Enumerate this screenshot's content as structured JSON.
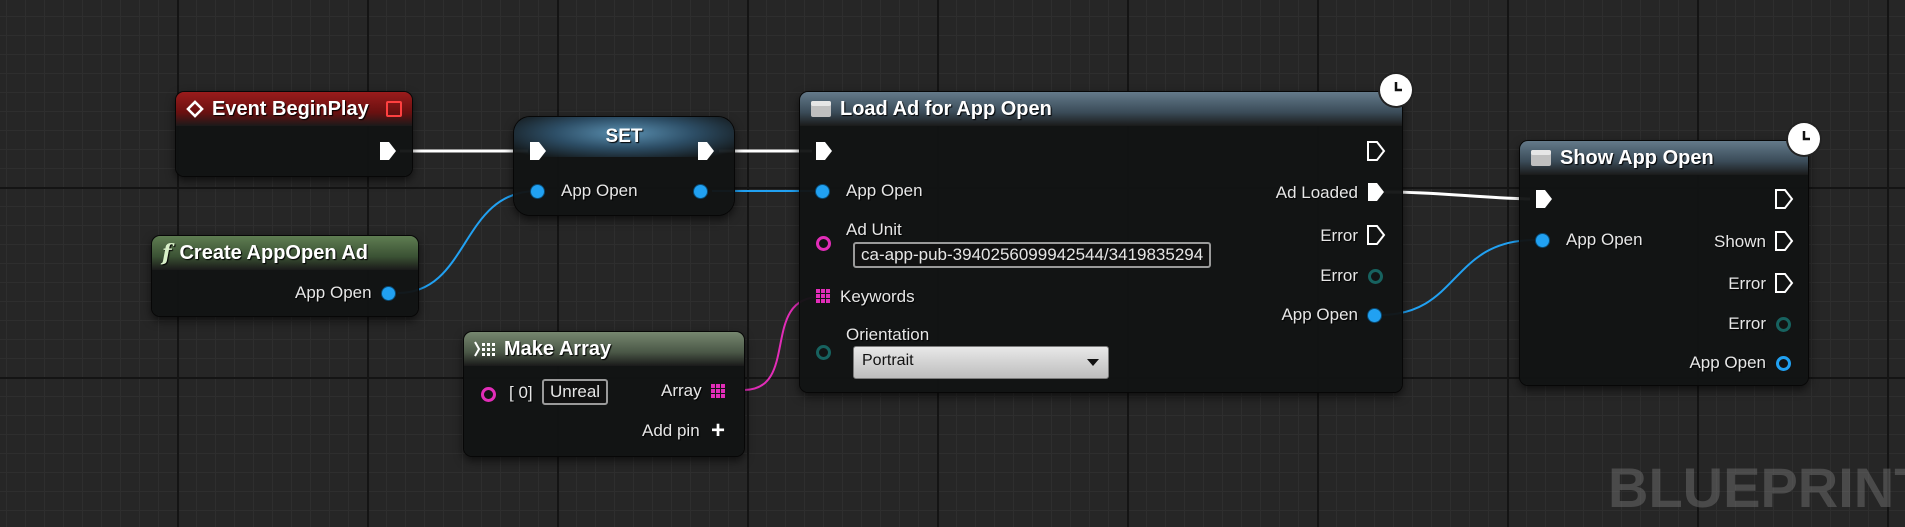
{
  "watermark": "BLUEPRINT",
  "colors": {
    "exec": "#ffffff",
    "object": "#21a1f2",
    "string": "#e22db8",
    "event_header": "#8a1a1a",
    "function_header": "#4e6a44",
    "async_header": "#51677a"
  },
  "nodes": {
    "event_begin_play": {
      "title": "Event BeginPlay"
    },
    "create_appopen_ad": {
      "title": "Create AppOpen Ad",
      "output_label": "App Open"
    },
    "set_node": {
      "title": "SET",
      "input_label": "App Open"
    },
    "make_array": {
      "title": "Make Array",
      "element_label": "[ 0]",
      "element_value": "Unreal",
      "output_label": "Array",
      "add_pin_label": "Add pin"
    },
    "load_ad": {
      "title": "Load Ad for App Open",
      "in_app_open": "App Open",
      "ad_unit_label": "Ad Unit",
      "ad_unit_value": "ca-app-pub-3940256099942544/3419835294",
      "keywords_label": "Keywords",
      "orientation_label": "Orientation",
      "orientation_value": "Portrait",
      "out_ad_loaded": "Ad Loaded",
      "out_error_exec": "Error",
      "out_error_data": "Error",
      "out_app_open": "App Open"
    },
    "show_app_open": {
      "title": "Show App Open",
      "in_app_open": "App Open",
      "out_shown": "Shown",
      "out_error_exec": "Error",
      "out_error_data": "Error",
      "out_app_open": "App Open"
    }
  }
}
